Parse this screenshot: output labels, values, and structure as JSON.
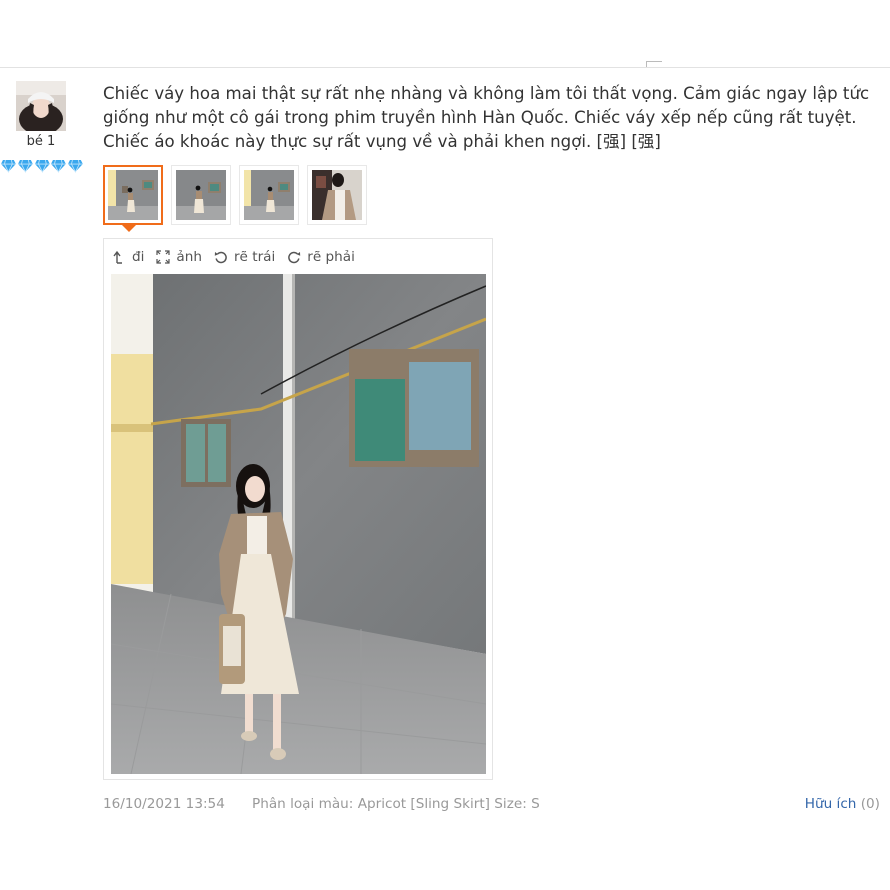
{
  "user": {
    "name": "bé 1",
    "rank_icon": "diamond-icon",
    "rank_count": 5,
    "rank_color": "#3aa8ee"
  },
  "review": {
    "text": "Chiếc váy hoa mai thật sự rất nhẹ nhàng và không làm tôi thất vọng. Cảm giác ngay lập tức giống như một cô gái trong phim truyền hình Hàn Quốc. Chiếc váy xếp nếp cũng rất tuyệt. Chiếc áo khoác này thực sự rất vụng về và phải khen ngợi. [强] [强]",
    "date": "16/10/2021 13:54",
    "sku": "Phân loại màu: Apricot [Sling Skirt] Size: S",
    "helpful_label": "Hữu ích",
    "helpful_count": "(0)"
  },
  "thumbnails": [
    {
      "selected": true
    },
    {
      "selected": false
    },
    {
      "selected": false
    },
    {
      "selected": false
    }
  ],
  "viewer": {
    "tools": [
      {
        "icon": "collapse-arrow-icon",
        "label": "đi"
      },
      {
        "icon": "expand-icon",
        "label": "ảnh"
      },
      {
        "icon": "rotate-left-icon",
        "label": "rẽ trái"
      },
      {
        "icon": "rotate-right-icon",
        "label": "rẽ phải"
      }
    ]
  },
  "colors": {
    "accent": "#f06c1a",
    "link": "#3366aa",
    "muted": "#999999"
  }
}
